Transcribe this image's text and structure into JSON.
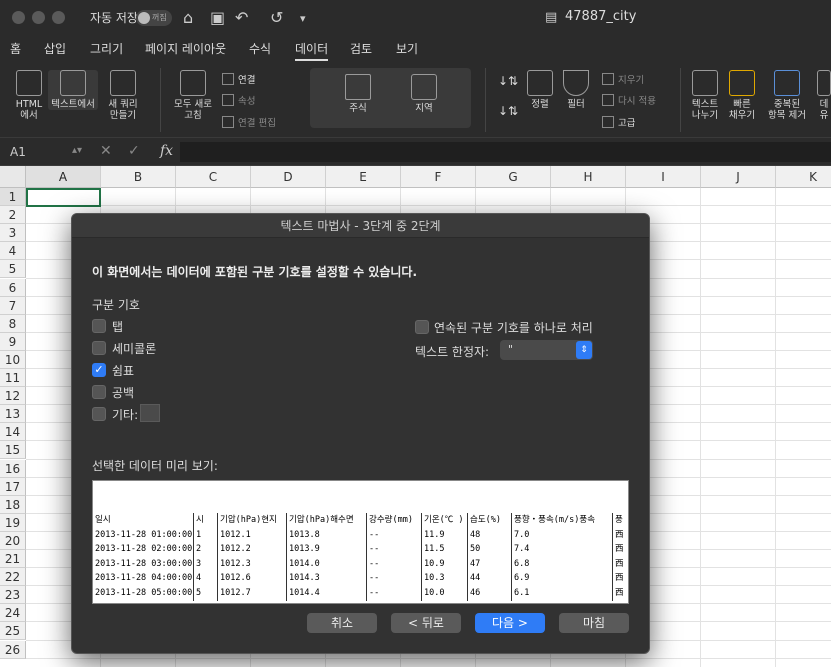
{
  "titlebar": {
    "autosave_label": "자동 저장",
    "toggle_state": "꺼짐",
    "doc_title": "47887_city"
  },
  "menu": [
    "홈",
    "삽입",
    "그리기",
    "페이지 레이아웃",
    "수식",
    "데이터",
    "검토",
    "보기"
  ],
  "ribbon": {
    "html": "HTML\n에서",
    "text": "텍스트에서",
    "newquery": "새 쿼리\n만들기",
    "refresh": "모두 새로\n고침",
    "connections": "연결",
    "properties": "속성",
    "edit_links": "연결 편집",
    "stocks": "주식",
    "geography": "지역",
    "sort": "정렬",
    "filter": "필터",
    "clear": "지우기",
    "reapply": "다시 적용",
    "advanced": "고급",
    "text_to_columns": "텍스트\n나누기",
    "flash_fill": "빠른\n채우기",
    "remove_dup": "중복된\n항목 제거",
    "validation": "데\n유"
  },
  "formula": {
    "namebox": "A1",
    "fx": "fx"
  },
  "grid": {
    "columns": [
      "A",
      "B",
      "C",
      "D",
      "E",
      "F",
      "G",
      "H",
      "I",
      "J",
      "K"
    ],
    "rows": [
      "1",
      "2",
      "3",
      "4",
      "5",
      "6",
      "7",
      "8",
      "9",
      "10",
      "11",
      "12",
      "13",
      "14",
      "15",
      "16",
      "17",
      "18",
      "19",
      "20",
      "21",
      "22",
      "23",
      "24",
      "25",
      "26"
    ]
  },
  "dialog": {
    "title": "텍스트 마법사 - 3단계 중 2단계",
    "heading": "이 화면에서는 데이터에 포함된 구분 기호를 설정할 수 있습니다.",
    "delims_label": "구분 기호",
    "tab": "탭",
    "semicolon": "세미콜론",
    "comma": "쉼표",
    "space": "공백",
    "other": "기타:",
    "consecutive": "연속된 구분 기호를 하나로 처리",
    "qualifier_label": "텍스트 한정자:",
    "qualifier_value": "\"",
    "preview_label": "선택한 데이터 미리 보기:",
    "preview": {
      "header": [
        "일시",
        "시",
        "기압(hPa)현지",
        "기압(hPa)해수면",
        "강수량(mm)",
        "기온(℃ )",
        "습도(%)",
        "풍향・풍속(m/s)풍속",
        "풍"
      ],
      "rows": [
        [
          "2013-11-28 01:00:00",
          "1",
          "1012.1",
          "1013.8",
          "--",
          "11.9",
          "48",
          "7.0",
          "西"
        ],
        [
          "2013-11-28 02:00:00",
          "2",
          "1012.2",
          "1013.9",
          "--",
          "11.5",
          "50",
          "7.4",
          "西"
        ],
        [
          "2013-11-28 03:00:00",
          "3",
          "1012.3",
          "1014.0",
          "--",
          "10.9",
          "47",
          "6.8",
          "西"
        ],
        [
          "2013-11-28 04:00:00",
          "4",
          "1012.6",
          "1014.3",
          "--",
          "10.3",
          "44",
          "6.9",
          "西"
        ],
        [
          "2013-11-28 05:00:00",
          "5",
          "1012.7",
          "1014.4",
          "--",
          "10.0",
          "46",
          "6.1",
          "西"
        ]
      ]
    },
    "buttons": {
      "cancel": "취소",
      "back": "< 뒤로",
      "next": "다음 >",
      "finish": "마침"
    }
  }
}
